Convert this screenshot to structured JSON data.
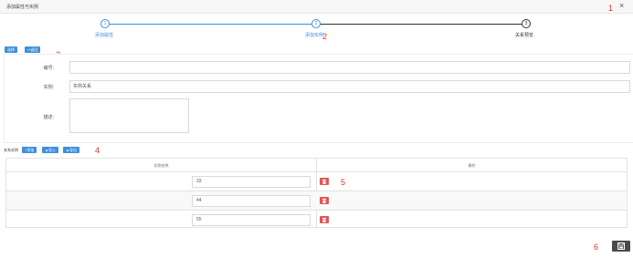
{
  "window": {
    "title": "添加属性与实例"
  },
  "annotations": [
    "1",
    "2",
    "3",
    "4",
    "5",
    "6"
  ],
  "steps": [
    {
      "number": "1",
      "label": "添加属性"
    },
    {
      "number": "2",
      "label": "添加实例"
    },
    {
      "number": "3",
      "label": "关系预览"
    }
  ],
  "toolbar": {
    "select_label": "选择",
    "back_label": "返回"
  },
  "form": {
    "code_label": "编号:",
    "code_value": "",
    "instance_label": "实例:",
    "instance_value": "实例关系",
    "desc_label": "描述:",
    "desc_value": ""
  },
  "relations": {
    "label": "关系实例",
    "add_label": "添加",
    "import_label": "导入",
    "export_label": "导出"
  },
  "table": {
    "columns": [
      "实例名称",
      "操作"
    ],
    "rows": [
      {
        "value": "33"
      },
      {
        "value": "44"
      },
      {
        "value": "55"
      }
    ]
  },
  "colors": {
    "accent": "#3d8fde",
    "danger": "#e45458",
    "annotation": "#e0322d"
  }
}
